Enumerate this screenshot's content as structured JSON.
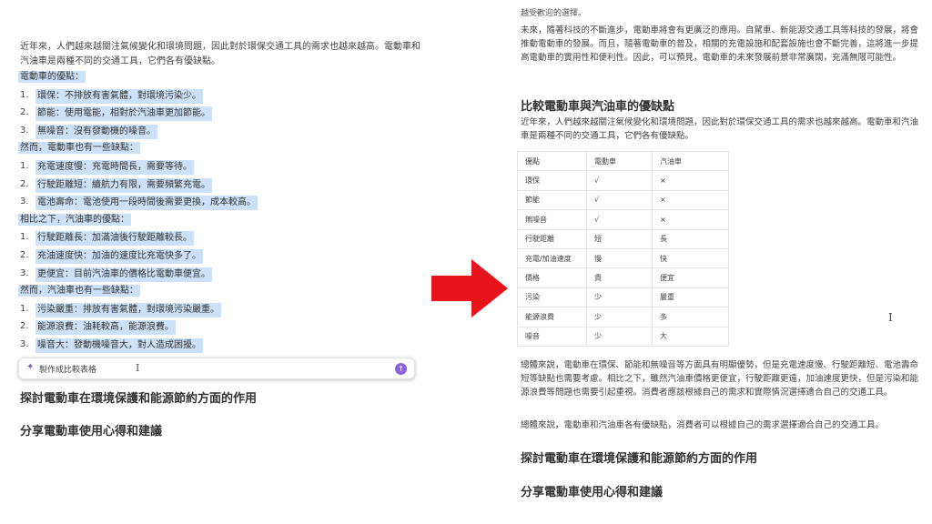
{
  "left": {
    "intro": "近年來，人們越來越關注氣候變化和環境問題，因此對於環保交通工具的需求也越來越高。電動車和汽油車是兩種不同的交通工具，它們各有優缺點。",
    "lines": [
      {
        "type": "heading",
        "text": "電動車的優點："
      },
      {
        "type": "item",
        "num": "1.",
        "text": "環保：不排放有害氣體，對環境污染少。"
      },
      {
        "type": "item",
        "num": "2.",
        "text": "節能：使用電能，相對於汽油車更加節能。"
      },
      {
        "type": "item",
        "num": "3.",
        "text": "無噪音：沒有發動機的噪音。"
      },
      {
        "type": "heading",
        "text": "然而，電動車也有一些缺點："
      },
      {
        "type": "item",
        "num": "1.",
        "text": "充電速度慢：充電時間長，需要等待。"
      },
      {
        "type": "item",
        "num": "2.",
        "text": "行駛距離短：續航力有限，需要頻繁充電。"
      },
      {
        "type": "item",
        "num": "3.",
        "text": "電池壽命：電池使用一段時間後需要更換，成本較高。"
      },
      {
        "type": "heading",
        "text": "相比之下，汽油車的優點："
      },
      {
        "type": "item",
        "num": "1.",
        "text": "行駛距離長：加滿油後行駛距離較長。"
      },
      {
        "type": "item",
        "num": "2.",
        "text": "充油速度快：加油的速度比充電快多了。"
      },
      {
        "type": "item",
        "num": "3.",
        "text": "更便宜：目前汽油車的價格比電動車便宜。"
      },
      {
        "type": "heading",
        "text": "然而，汽油車也有一些缺點："
      },
      {
        "type": "item",
        "num": "1.",
        "text": "污染嚴重：排放有害氣體，對環境污染嚴重。"
      },
      {
        "type": "item",
        "num": "2.",
        "text": "能源浪費：油耗較高，能源浪費。"
      },
      {
        "type": "item",
        "num": "3.",
        "text": "噪音大：發動機噪音大，對人造成困擾。"
      }
    ],
    "prompt": {
      "text": "製作成比較表格",
      "sparkle_icon": "sparkle-icon",
      "send_icon": "arrow-up-icon"
    },
    "headings": [
      "探討電動車在環境保護和能源節約方面的作用",
      "分享電動車使用心得和建議"
    ]
  },
  "right": {
    "cut_text": "越受歡迎的選擇。",
    "para1": "未來，隨著科技的不斷進步，電動車將會有更廣泛的應用。自駕車、新能源交通工具等科技的發展，將會推動電動車的發展。而且，隨著電動車的普及，相關的充電設施和配套設施也會不斷完善，這將進一步提高電動車的實用性和便利性。因此，可以預見，電動車的未來發展前景非常廣闊，充滿無限可能性。",
    "section_title": "比較電動車與汽油車的優缺點",
    "para2": "近年來，人們越來越關注氣候變化和環境問題，因此對於環保交通工具的需求也越來越高。電動車和汽油車是兩種不同的交通工具，它們各有優缺點。",
    "table": {
      "headers": [
        "優點",
        "電動車",
        "汽油車"
      ],
      "rows": [
        [
          "環保",
          "√",
          "×"
        ],
        [
          "節能",
          "√",
          "×"
        ],
        [
          "無噪音",
          "√",
          "×"
        ],
        [
          "行駛距離",
          "短",
          "長"
        ],
        [
          "充電/加油速度",
          "慢",
          "快"
        ],
        [
          "價格",
          "貴",
          "便宜"
        ],
        [
          "污染",
          "少",
          "嚴重"
        ],
        [
          "能源浪費",
          "少",
          "多"
        ],
        [
          "噪音",
          "少",
          "大"
        ]
      ]
    },
    "para3": "總體來說，電動車在環保、節能和無噪音等方面具有明顯優勢，但是充電速度慢、行駛距離短、電池壽命短等缺點也需要考慮。相比之下，雖然汽油車價格更便宜，行駛距離更遠，加油速度更快，但是污染和能源浪費等問題也需要引起重視。消費者應該根據自己的需求和實際情況選擇適合自己的交通工具。",
    "para4": "總體來說，電動車和汽油車各有優缺點，消費者可以根據自己的需求選擇適合自己的交通工具。",
    "headings": [
      "探討電動車在環境保護和能源節約方面的作用",
      "分享電動車使用心得和建議"
    ]
  },
  "colors": {
    "highlight": "#cce0f7",
    "arrow": "#e8141b",
    "accent": "#8e63d9"
  }
}
